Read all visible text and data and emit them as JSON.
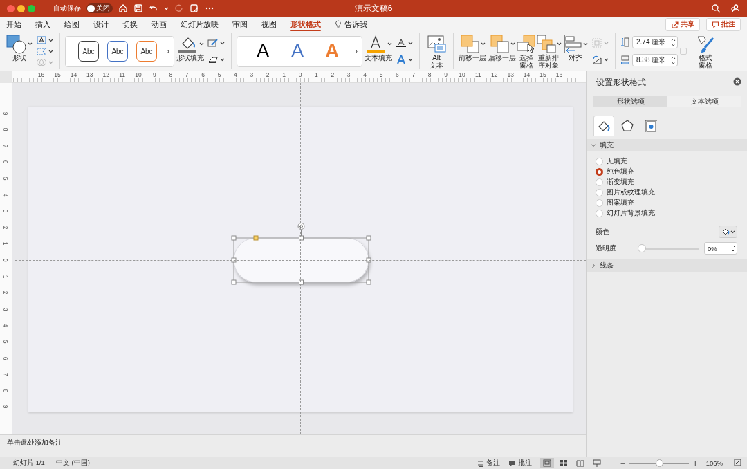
{
  "window": {
    "title": "演示文稿6"
  },
  "autosave": {
    "label": "自动保存",
    "on": false,
    "toggle_text": "关闭"
  },
  "tabs": [
    {
      "label": "开始",
      "selected": false
    },
    {
      "label": "插入",
      "selected": false
    },
    {
      "label": "绘图",
      "selected": false
    },
    {
      "label": "设计",
      "selected": false
    },
    {
      "label": "切换",
      "selected": false
    },
    {
      "label": "动画",
      "selected": false
    },
    {
      "label": "幻灯片放映",
      "selected": false
    },
    {
      "label": "审阅",
      "selected": false
    },
    {
      "label": "视图",
      "selected": false
    },
    {
      "label": "形状格式",
      "selected": true
    }
  ],
  "tell_me": "告诉我",
  "share_button": "共享",
  "comments_button": "批注",
  "ribbon": [
    [
      {
        "kind": "shapes",
        "label": "形状",
        "has_menu": true
      },
      {
        "kind": "stack",
        "items": [
          {
            "kind": "textbox",
            "disabled": false
          },
          {
            "kind": "editshape",
            "disabled": false
          },
          {
            "kind": "merge",
            "disabled": true
          }
        ]
      }
    ],
    [
      {
        "kind": "styles",
        "more": "›",
        "samples": [
          {
            "text": "Abc",
            "color": "#404040"
          },
          {
            "text": "Abc",
            "color": "#4472c4"
          },
          {
            "text": "Abc",
            "color": "#ed7d31"
          }
        ]
      },
      {
        "kind": "shapefill",
        "label": "形状填充",
        "has_menu": true
      },
      {
        "kind": "stack",
        "items": [
          {
            "kind": "outline",
            "disabled": false
          },
          {
            "kind": "effects",
            "disabled": false
          }
        ]
      }
    ],
    [
      {
        "kind": "wordart",
        "more": "›",
        "samples": [
          {
            "text": "A",
            "color": "#000000",
            "outlined": false
          },
          {
            "text": "A",
            "color": "#4472c4",
            "outlined": false
          },
          {
            "text": "A",
            "color": "#ed7d31",
            "outlined": true
          }
        ]
      },
      {
        "kind": "textfill",
        "label": "文本填充",
        "has_menu": true
      },
      {
        "kind": "stack",
        "items": [
          {
            "kind": "textoutline",
            "disabled": false
          },
          {
            "kind": "texteffects",
            "disabled": false
          }
        ]
      }
    ],
    [
      {
        "kind": "alttext",
        "label": "Alt\n文本",
        "has_menu": false
      }
    ],
    [
      {
        "kind": "forward",
        "label": "前移一层",
        "has_menu": true
      },
      {
        "kind": "backward",
        "label": "后移一层",
        "has_menu": true
      },
      {
        "kind": "selpane",
        "label": "选择窗格",
        "has_menu": false
      },
      {
        "kind": "reorder",
        "label": "重新排序对象",
        "has_menu": true
      },
      {
        "kind": "align",
        "label": "对齐",
        "has_menu": true
      },
      {
        "kind": "stack",
        "items": [
          {
            "kind": "group",
            "disabled": true
          },
          {
            "kind": "rotate",
            "disabled": false
          }
        ]
      }
    ],
    [
      {
        "kind": "size",
        "fields": [
          {
            "kind": "height",
            "value": "2.74 厘米"
          },
          {
            "kind": "width",
            "value": "8.38 厘米"
          }
        ],
        "lock_disabled": true
      }
    ],
    [
      {
        "kind": "formatpane",
        "label": "格式窗格",
        "has_menu": false
      }
    ]
  ],
  "rulers": {
    "horizontal": [
      "16",
      "15",
      "14",
      "13",
      "12",
      "11",
      "10",
      "9",
      "8",
      "7",
      "6",
      "5",
      "4",
      "3",
      "2",
      "1",
      "0",
      "1",
      "2",
      "3",
      "4",
      "5",
      "6",
      "7",
      "8",
      "9",
      "10",
      "11",
      "12",
      "13",
      "14",
      "15",
      "16"
    ],
    "vertical": [
      "9",
      "8",
      "7",
      "6",
      "5",
      "4",
      "3",
      "2",
      "1",
      "0",
      "1",
      "2",
      "3",
      "4",
      "5",
      "6",
      "7",
      "8",
      "9"
    ]
  },
  "slide": {
    "shape": {
      "kind": "pill",
      "selected": true
    }
  },
  "notes_placeholder": "单击此处添加备注",
  "format_pane": {
    "title": "设置形状格式",
    "tabs": [
      {
        "label": "形状选项",
        "selected": true
      },
      {
        "label": "文本选项",
        "selected": false
      }
    ],
    "icon_tabs": [
      {
        "kind": "fill",
        "selected": true
      },
      {
        "kind": "effects",
        "selected": false
      },
      {
        "kind": "size",
        "selected": false
      }
    ],
    "sections": [
      {
        "title": "填充",
        "expanded": true,
        "options": [
          {
            "label": "无填充",
            "selected": false
          },
          {
            "label": "纯色填充",
            "selected": true
          },
          {
            "label": "渐变填充",
            "selected": false
          },
          {
            "label": "图片或纹理填充",
            "selected": false
          },
          {
            "label": "图案填充",
            "selected": false
          },
          {
            "label": "幻灯片背景填充",
            "selected": false
          }
        ],
        "color_label": "颜色",
        "transparency": {
          "label": "透明度",
          "level": 0,
          "value": "0%"
        }
      },
      {
        "title": "线条",
        "expanded": false
      }
    ]
  },
  "status_bar": {
    "slide": "幻灯片 1/1",
    "language": "中文 (中国)",
    "notes": "备注",
    "comments": "批注",
    "views": [
      {
        "kind": "normal",
        "selected": true
      },
      {
        "kind": "sorter",
        "selected": false
      },
      {
        "kind": "reading",
        "selected": false
      },
      {
        "kind": "slideshow",
        "selected": false
      }
    ],
    "zoom": {
      "minus": "−",
      "plus": "+",
      "level": 0.5,
      "value": "106%"
    }
  }
}
